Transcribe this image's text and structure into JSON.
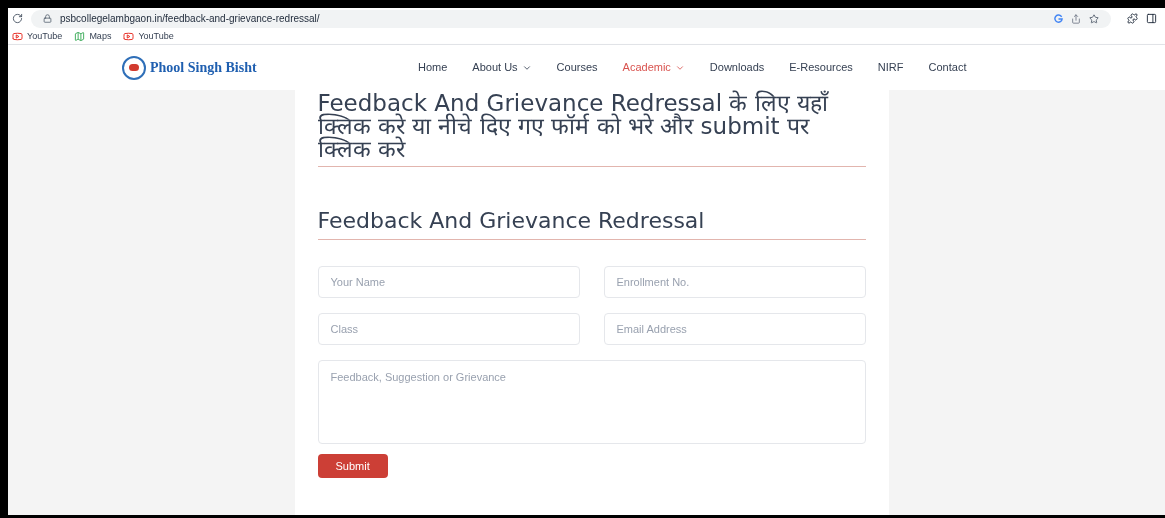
{
  "browser": {
    "url": "psbcollegelambgaon.in/feedback-and-grievance-redressal/",
    "bookmarks": [
      {
        "kind": "video",
        "label": "YouTube"
      },
      {
        "kind": "map",
        "label": "Maps"
      },
      {
        "kind": "video",
        "label": "YouTube"
      }
    ]
  },
  "site": {
    "logo_text": "Phool Singh Bisht",
    "nav": [
      {
        "label": "Home",
        "selected": false,
        "has_menu": false
      },
      {
        "label": "About Us",
        "selected": false,
        "has_menu": true
      },
      {
        "label": "Courses",
        "selected": false,
        "has_menu": false
      },
      {
        "label": "Academic",
        "selected": true,
        "has_menu": true
      },
      {
        "label": "Downloads",
        "selected": false,
        "has_menu": false
      },
      {
        "label": "E-Resources",
        "selected": false,
        "has_menu": false
      },
      {
        "label": "NIRF",
        "selected": false,
        "has_menu": false
      },
      {
        "label": "Contact",
        "selected": false,
        "has_menu": false
      }
    ]
  },
  "content": {
    "intro_heading": "Feedback And Grievance Redressal के लिए यहाँ क्लिक करे या नीचे दिए गए फॉर्म को भरे और submit पर क्लिक करे",
    "form_heading": "Feedback And Grievance Redressal",
    "fields": [
      {
        "placeholder": "Your Name"
      },
      {
        "placeholder": "Enrollment No."
      },
      {
        "placeholder": "Class"
      },
      {
        "placeholder": "Email Address"
      }
    ],
    "message": {
      "placeholder": "Feedback, Suggestion or Grievance"
    },
    "submit": "Submit"
  }
}
